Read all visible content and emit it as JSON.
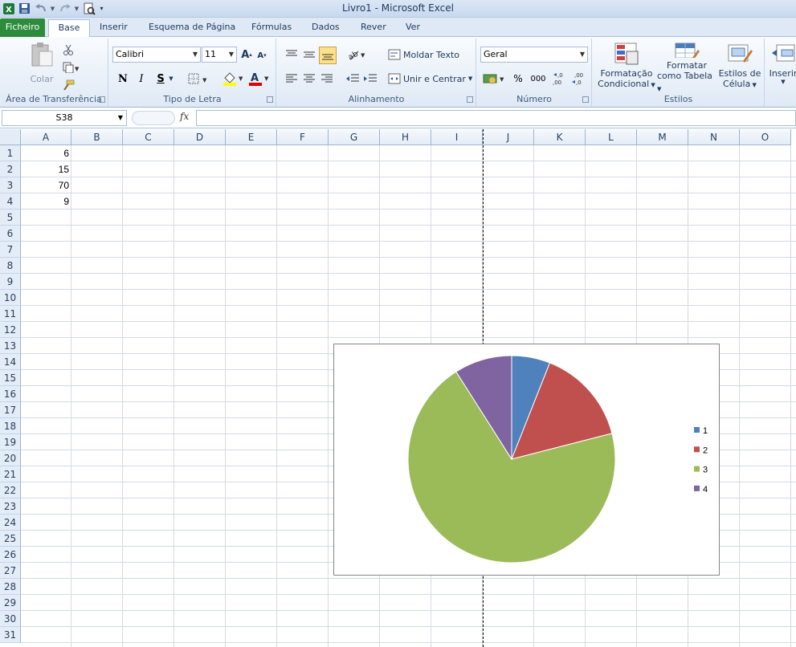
{
  "window": {
    "title": "Livro1  -  Microsoft Excel"
  },
  "tabs": [
    "Ficheiro",
    "Base",
    "Inserir",
    "Esquema de Página",
    "Fórmulas",
    "Dados",
    "Rever",
    "Ver"
  ],
  "ribbon": {
    "clipboard": {
      "label": "Área de Transferência",
      "paste": "Colar"
    },
    "font": {
      "label": "Tipo de Letra",
      "name": "Calibri",
      "size": "11",
      "bold": "N",
      "italic": "I",
      "underline": "S"
    },
    "alignment": {
      "label": "Alinhamento",
      "wrap": "Moldar Texto",
      "merge": "Unir e Centrar"
    },
    "number": {
      "label": "Número",
      "format": "Geral",
      "percent": "%",
      "thousands": "000"
    },
    "styles": {
      "label": "Estilos",
      "conditional": [
        "Formatação",
        "Condicional"
      ],
      "table": [
        "Formatar",
        "como Tabela"
      ],
      "cell": [
        "Estilos de",
        "Célula"
      ]
    },
    "cells": {
      "insert": "Inserir"
    }
  },
  "formula_bar": {
    "name_box": "S38",
    "fx": "fx",
    "value": ""
  },
  "grid": {
    "columns": [
      "A",
      "B",
      "C",
      "D",
      "E",
      "F",
      "G",
      "H",
      "I",
      "J",
      "K",
      "L",
      "M",
      "N",
      "O"
    ],
    "rows": [
      "1",
      "2",
      "3",
      "4",
      "5",
      "6",
      "7",
      "8",
      "9",
      "10",
      "11",
      "12",
      "13",
      "14",
      "15",
      "16",
      "17",
      "18",
      "19",
      "20",
      "21",
      "22",
      "23",
      "24",
      "25",
      "26",
      "27",
      "28",
      "29",
      "30",
      "31"
    ],
    "cells": [
      {
        "ref": "A1",
        "value": "6"
      },
      {
        "ref": "A2",
        "value": "15"
      },
      {
        "ref": "A3",
        "value": "70"
      },
      {
        "ref": "A4",
        "value": "9"
      }
    ]
  },
  "chart_data": {
    "type": "pie",
    "title": "",
    "categories": [
      "1",
      "2",
      "3",
      "4"
    ],
    "values": [
      6,
      15,
      70,
      9
    ],
    "colors": [
      "#4f81bd",
      "#c0504d",
      "#9bbb59",
      "#8064a2"
    ],
    "legend_position": "right"
  }
}
